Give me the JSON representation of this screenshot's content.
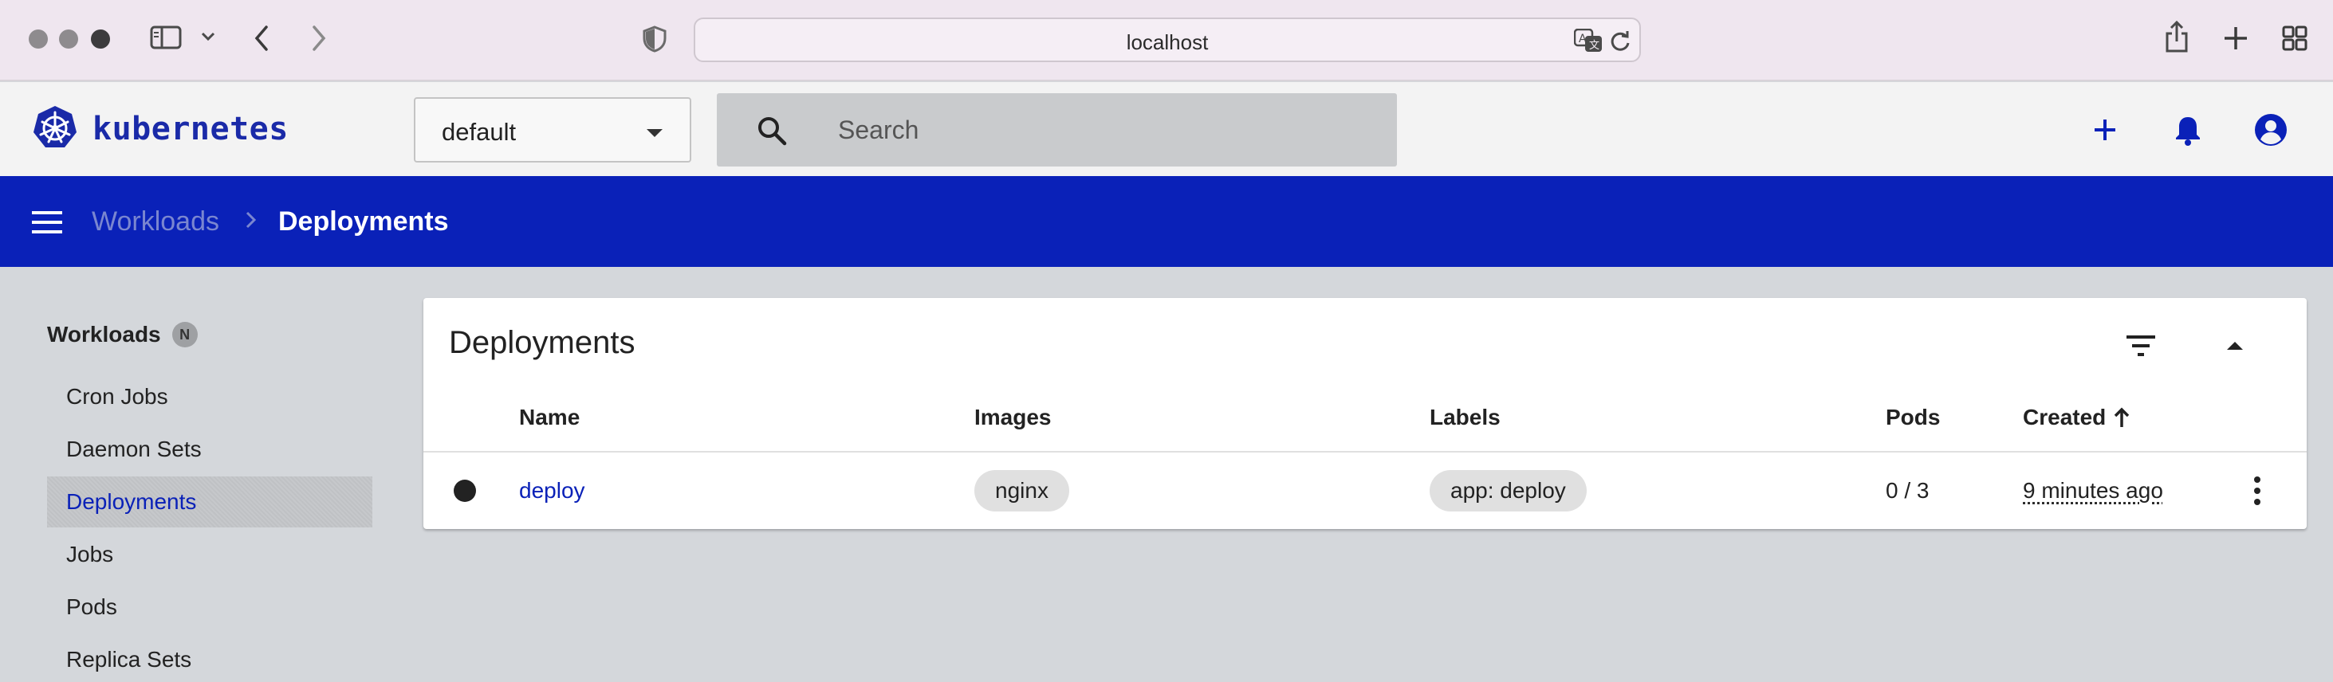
{
  "browser": {
    "url": "localhost"
  },
  "header": {
    "logo_text": "kubernetes",
    "namespace": "default",
    "search_placeholder": "Search"
  },
  "toolbar": {
    "breadcrumb_parent": "Workloads",
    "breadcrumb_current": "Deployments"
  },
  "sidebar": {
    "section_label": "Workloads",
    "section_badge": "N",
    "items": [
      {
        "label": "Cron Jobs",
        "active": false
      },
      {
        "label": "Daemon Sets",
        "active": false
      },
      {
        "label": "Deployments",
        "active": true
      },
      {
        "label": "Jobs",
        "active": false
      },
      {
        "label": "Pods",
        "active": false
      },
      {
        "label": "Replica Sets",
        "active": false
      }
    ]
  },
  "card": {
    "title": "Deployments",
    "columns": [
      "Name",
      "Images",
      "Labels",
      "Pods",
      "Created"
    ],
    "sort_column": "Created",
    "rows": [
      {
        "name": "deploy",
        "image": "nginx",
        "label": "app: deploy",
        "pods": "0 / 3",
        "created": "9 minutes ago"
      }
    ]
  },
  "colors": {
    "brand_blue": "#0a21b8",
    "page_bg": "#d4d7db",
    "header_bg": "#f3f3f3"
  },
  "icons": [
    "sidebar-toggle-icon",
    "chevron-down-icon",
    "back-icon",
    "forward-icon",
    "shield-icon",
    "translate-icon",
    "reload-icon",
    "share-icon",
    "new-tab-icon",
    "tab-overview-icon",
    "kubernetes-logo-icon",
    "search-icon",
    "plus-icon",
    "bell-icon",
    "account-icon",
    "menu-icon",
    "chevron-right-icon",
    "filter-icon",
    "collapse-icon",
    "arrow-up-icon",
    "more-vert-icon"
  ]
}
